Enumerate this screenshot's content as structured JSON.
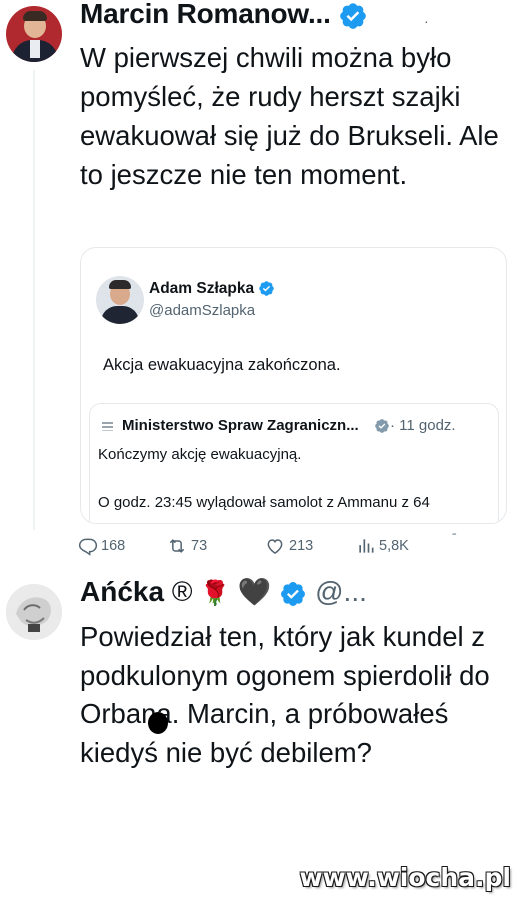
{
  "post": {
    "author_name": "Marcin Romanow...",
    "verified_icon": "verified-badge-icon",
    "text": "W pierwszej chwili można było pomyśleć, że rudy herszt szajki ewakuował się już do Brukseli. Ale to jeszcze nie ten moment."
  },
  "quote": {
    "author_name": "Adam Szłapka",
    "handle": "@adamSzlapka",
    "text": "Akcja ewakuacyjna zakończona.",
    "nested": {
      "author_name": "Ministerstwo Spraw Zagraniczn...",
      "time": "· 11 godz.",
      "line1": "Kończymy akcję ewakuacyjną.",
      "line2": "O godz. 23:45 wylądował samolot z Ammanu z 64"
    }
  },
  "actions": {
    "replies": "168",
    "reposts": "73",
    "likes": "213",
    "views": "5,8K"
  },
  "reply": {
    "author_name": "Ańćka",
    "registered_mark": "®",
    "rose_emoji": "🌹",
    "heart_emoji": "🖤",
    "handle": "@...",
    "text": "Powiedział ten, który jak kundel z podkulonym ogonem spierdolił do Orbana. Marcin, a próbowałeś kiedyś nie być debilem?"
  },
  "watermark": "www.wiocha.pl",
  "colors": {
    "verified": "#1d9bf0",
    "secondary_text": "#536471"
  }
}
